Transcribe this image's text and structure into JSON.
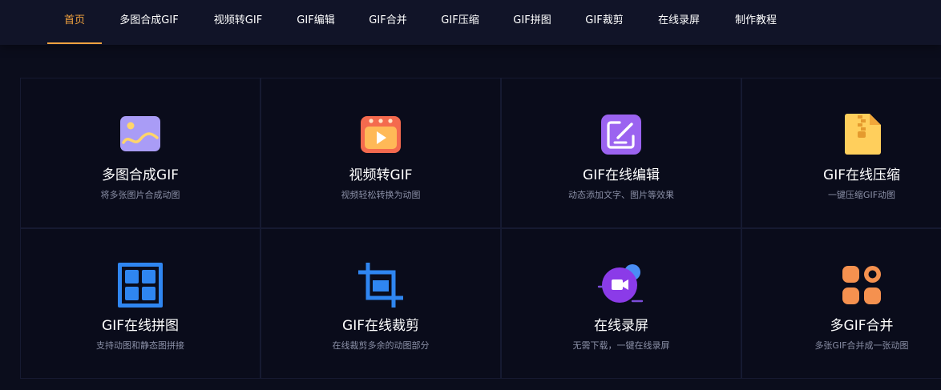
{
  "nav": {
    "items": [
      {
        "label": "首页",
        "active": true
      },
      {
        "label": "多图合成GIF"
      },
      {
        "label": "视频转GIF"
      },
      {
        "label": "GIF编辑"
      },
      {
        "label": "GIF合并"
      },
      {
        "label": "GIF压缩"
      },
      {
        "label": "GIF拼图"
      },
      {
        "label": "GIF裁剪"
      },
      {
        "label": "在线录屏"
      },
      {
        "label": "制作教程"
      }
    ],
    "active_color": "#f1a23f"
  },
  "tools": [
    {
      "title": "多图合成GIF",
      "desc": "将多张图片合成动图",
      "icon": "image-icon"
    },
    {
      "title": "视频转GIF",
      "desc": "视频轻松转换为动图",
      "icon": "video-play-icon"
    },
    {
      "title": "GIF在线编辑",
      "desc": "动态添加文字、图片等效果",
      "icon": "edit-icon"
    },
    {
      "title": "GIF在线压缩",
      "desc": "一键压缩GIF动图",
      "icon": "zip-file-icon"
    },
    {
      "title": "GIF在线拼图",
      "desc": "支持动图和静态图拼接",
      "icon": "grid-icon"
    },
    {
      "title": "GIF在线裁剪",
      "desc": "在线裁剪多余的动图部分",
      "icon": "crop-icon"
    },
    {
      "title": "在线录屏",
      "desc": "无需下载，一键在线录屏",
      "icon": "screen-record-icon"
    },
    {
      "title": "多GIF合并",
      "desc": "多张GIF合并成一张动图",
      "icon": "merge-icon"
    }
  ]
}
